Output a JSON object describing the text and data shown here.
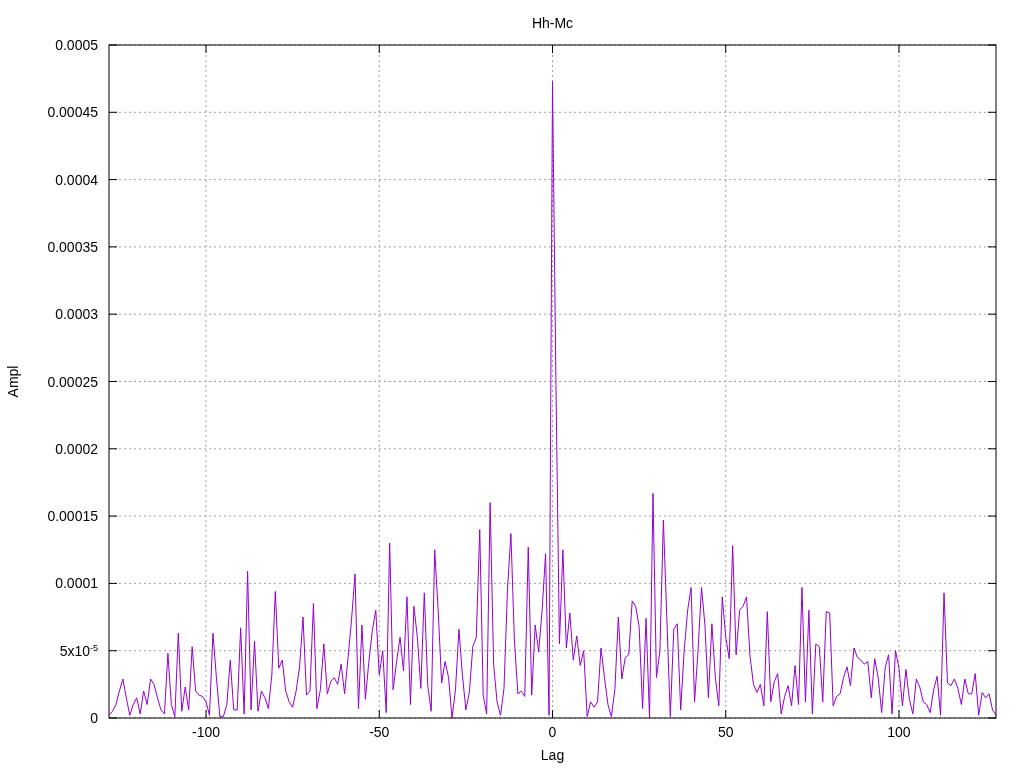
{
  "chart_data": {
    "type": "line",
    "title": "Hh-Mc",
    "xlabel": "Lag",
    "ylabel": "Ampl",
    "xlim": [
      -128,
      128
    ],
    "ylim": [
      0,
      0.0005
    ],
    "xticks": [
      -100,
      -50,
      0,
      50,
      100
    ],
    "yticks": [
      {
        "value": 0,
        "label": "0"
      },
      {
        "value": 5e-05,
        "label": "5x10$^{-5}$"
      },
      {
        "value": 0.0001,
        "label": "0.0001"
      },
      {
        "value": 0.00015,
        "label": "0.00015"
      },
      {
        "value": 0.0002,
        "label": "0.0002"
      },
      {
        "value": 0.00025,
        "label": "0.00025"
      },
      {
        "value": 0.0003,
        "label": "0.0003"
      },
      {
        "value": 0.00035,
        "label": "0.00035"
      },
      {
        "value": 0.0004,
        "label": "0.0004"
      },
      {
        "value": 0.00045,
        "label": "0.00045"
      },
      {
        "value": 0.0005,
        "label": "0.0005"
      }
    ],
    "x": [
      -128,
      -127,
      -126,
      -125,
      -124,
      -123,
      -122,
      -121,
      -120,
      -119,
      -118,
      -117,
      -116,
      -115,
      -114,
      -113,
      -112,
      -111,
      -110,
      -109,
      -108,
      -107,
      -106,
      -105,
      -104,
      -103,
      -102,
      -101,
      -100,
      -99,
      -98,
      -97,
      -96,
      -95,
      -94,
      -93,
      -92,
      -91,
      -90,
      -89,
      -88,
      -87,
      -86,
      -85,
      -84,
      -83,
      -82,
      -81,
      -80,
      -79,
      -78,
      -77,
      -76,
      -75,
      -74,
      -73,
      -72,
      -71,
      -70,
      -69,
      -68,
      -67,
      -66,
      -65,
      -64,
      -63,
      -62,
      -61,
      -60,
      -59,
      -58,
      -57,
      -56,
      -55,
      -54,
      -53,
      -52,
      -51,
      -50,
      -49,
      -48,
      -47,
      -46,
      -45,
      -44,
      -43,
      -42,
      -41,
      -40,
      -39,
      -38,
      -37,
      -36,
      -35,
      -34,
      -33,
      -32,
      -31,
      -30,
      -29,
      -28,
      -27,
      -26,
      -25,
      -24,
      -23,
      -22,
      -21,
      -20,
      -19,
      -18,
      -17,
      -16,
      -15,
      -14,
      -13,
      -12,
      -11,
      -10,
      -9,
      -8,
      -7,
      -6,
      -5,
      -4,
      -3,
      -2,
      -1,
      0,
      1,
      2,
      3,
      4,
      5,
      6,
      7,
      8,
      9,
      10,
      11,
      12,
      13,
      14,
      15,
      16,
      17,
      18,
      19,
      20,
      21,
      22,
      23,
      24,
      25,
      26,
      27,
      28,
      29,
      30,
      31,
      32,
      33,
      34,
      35,
      36,
      37,
      38,
      39,
      40,
      41,
      42,
      43,
      44,
      45,
      46,
      47,
      48,
      49,
      50,
      51,
      52,
      53,
      54,
      55,
      56,
      57,
      58,
      59,
      60,
      61,
      62,
      63,
      64,
      65,
      66,
      67,
      68,
      69,
      70,
      71,
      72,
      73,
      74,
      75,
      76,
      77,
      78,
      79,
      80,
      81,
      82,
      83,
      84,
      85,
      86,
      87,
      88,
      89,
      90,
      91,
      92,
      93,
      94,
      95,
      96,
      97,
      98,
      99,
      100,
      101,
      102,
      103,
      104,
      105,
      106,
      107,
      108,
      109,
      110,
      111,
      112,
      113,
      114,
      115,
      116,
      117,
      118,
      119,
      120,
      121,
      122,
      123,
      124,
      125,
      126,
      127,
      128
    ],
    "grid": true,
    "series": [
      {
        "color": "#9400d3",
        "values": [
          2e-06,
          5e-06,
          1e-05,
          2e-05,
          2.9e-05,
          1.5e-05,
          2e-06,
          1e-05,
          1.5e-05,
          3e-06,
          2e-05,
          1e-05,
          2.9e-05,
          2.5e-05,
          1.5e-05,
          6e-06,
          3e-06,
          4.8e-05,
          1e-05,
          1e-06,
          6.3e-05,
          5e-06,
          2.3e-05,
          6e-06,
          5.3e-05,
          2e-05,
          1.7e-05,
          1.6e-05,
          1.2e-05,
          2e-06,
          6.3e-05,
          3e-05,
          1e-06,
          1e-06,
          1e-05,
          4.3e-05,
          6e-06,
          6e-06,
          6.7e-05,
          3e-06,
          0.000109,
          6e-06,
          5.7e-05,
          5e-06,
          2e-05,
          1.5e-05,
          7e-06,
          3.2e-05,
          9.4e-05,
          3.7e-05,
          4.3e-05,
          2e-05,
          1.2e-05,
          8e-06,
          2e-05,
          3.8e-05,
          7.5e-05,
          1.7e-05,
          2e-05,
          8.5e-05,
          7e-06,
          2.1e-05,
          5.5e-05,
          1.8e-05,
          2.7e-05,
          3e-05,
          2.5e-05,
          4e-05,
          1.8e-05,
          4.5e-05,
          7.3e-05,
          0.000107,
          7e-06,
          6.9e-05,
          1.4e-05,
          4.2e-05,
          6.5e-05,
          8e-05,
          3.2e-05,
          5e-05,
          4e-06,
          0.00013,
          2.1e-05,
          4.2e-05,
          6e-05,
          3.5e-05,
          9e-05,
          1e-05,
          8.3e-05,
          6e-05,
          2.2e-05,
          9.3e-05,
          2.4e-05,
          5e-06,
          0.000125,
          8e-05,
          2.6e-05,
          4.2e-05,
          3e-05,
          0,
          2.1e-05,
          6.6e-05,
          3.2e-05,
          6e-06,
          1.9e-05,
          5.3e-05,
          6e-05,
          0.00014,
          1.7e-05,
          3e-06,
          0.00016,
          4e-05,
          1.2e-05,
          2e-06,
          2.2e-05,
          9.5e-05,
          0.000137,
          5.8e-05,
          1.8e-05,
          2e-05,
          1.6e-05,
          0.000127,
          1.7e-05,
          6.9e-05,
          4.9e-05,
          8e-05,
          0.000122,
          2e-06,
          0.000473,
          0.000247,
          5.5e-05,
          0.000125,
          5.2e-05,
          7.8e-05,
          4.3e-05,
          6.1e-05,
          3.9e-05,
          5e-05,
          1e-06,
          1.2e-05,
          8e-06,
          1.2e-05,
          5.2e-05,
          3e-05,
          1e-05,
          1e-06,
          2.1e-05,
          7.5e-05,
          2.9e-05,
          4.5e-05,
          4.7e-05,
          8.7e-05,
          8.3e-05,
          6.8e-05,
          7e-06,
          7.4e-05,
          0,
          0.000167,
          3e-05,
          5e-05,
          0.000147,
          7.4e-05,
          1e-06,
          6.6e-05,
          7e-05,
          6e-06,
          5e-05,
          8e-05,
          9.7e-05,
          1.2e-05,
          5e-05,
          9.7e-05,
          6.9e-05,
          1.5e-05,
          7e-05,
          3e-05,
          9e-06,
          9e-05,
          6e-05,
          4.4e-05,
          0.000128,
          4.7e-05,
          8e-05,
          8.3e-05,
          9e-05,
          4.6e-05,
          2.5e-05,
          1.9e-05,
          2.5e-05,
          9e-06,
          7.9e-05,
          1.2e-05,
          2.7e-05,
          3.3e-05,
          3e-06,
          1.6e-05,
          2.4e-05,
          9e-06,
          3.9e-05,
          1e-05,
          9.7e-05,
          1.2e-05,
          8e-05,
          3e-06,
          5.5e-05,
          5.3e-05,
          1.2e-05,
          7.9e-05,
          7.8e-05,
          9e-06,
          1.6e-05,
          1.8e-05,
          3e-05,
          3.8e-05,
          2.4e-05,
          5.2e-05,
          4.5e-05,
          4.3e-05,
          4e-05,
          4.2e-05,
          1.5e-05,
          4.4e-05,
          3e-05,
          4e-06,
          3.7e-05,
          4.7e-05,
          3e-06,
          5e-05,
          3.7e-05,
          9e-06,
          3.6e-05,
          1.4e-05,
          3e-06,
          2.9e-05,
          2.3e-05,
          1.2e-05,
          1e-05,
          4e-06,
          2.1e-05,
          3.1e-05,
          2e-06,
          9.3e-05,
          2.6e-05,
          2.4e-05,
          2.9e-05,
          2.2e-05,
          1e-05,
          2.9e-05,
          1.8e-05,
          1.8e-05,
          3.3e-05,
          2e-06,
          1.9e-05,
          1.5e-05,
          1.8e-05,
          6e-06,
          2e-06
        ]
      }
    ]
  }
}
